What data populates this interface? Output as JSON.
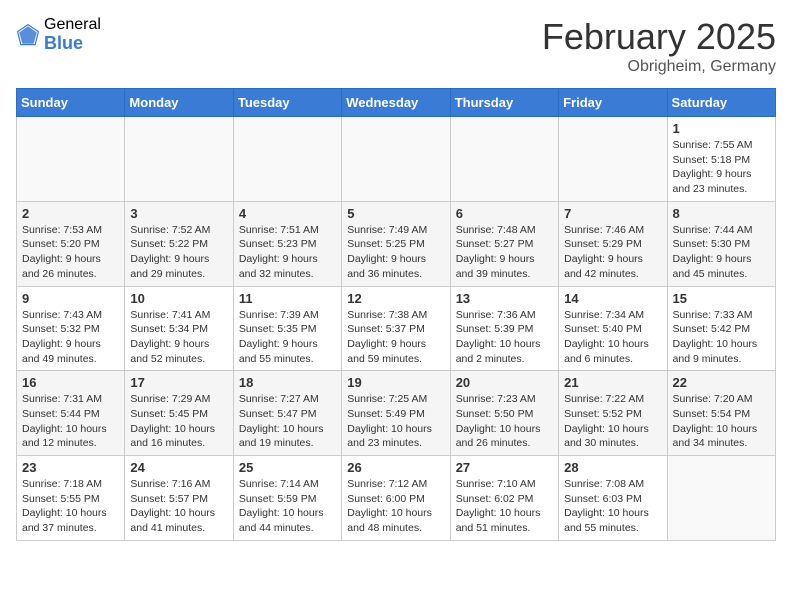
{
  "header": {
    "logo_general": "General",
    "logo_blue": "Blue",
    "month_title": "February 2025",
    "location": "Obrigheim, Germany"
  },
  "days_of_week": [
    "Sunday",
    "Monday",
    "Tuesday",
    "Wednesday",
    "Thursday",
    "Friday",
    "Saturday"
  ],
  "weeks": [
    [
      {
        "day": "",
        "info": ""
      },
      {
        "day": "",
        "info": ""
      },
      {
        "day": "",
        "info": ""
      },
      {
        "day": "",
        "info": ""
      },
      {
        "day": "",
        "info": ""
      },
      {
        "day": "",
        "info": ""
      },
      {
        "day": "1",
        "info": "Sunrise: 7:55 AM\nSunset: 5:18 PM\nDaylight: 9 hours and 23 minutes."
      }
    ],
    [
      {
        "day": "2",
        "info": "Sunrise: 7:53 AM\nSunset: 5:20 PM\nDaylight: 9 hours and 26 minutes."
      },
      {
        "day": "3",
        "info": "Sunrise: 7:52 AM\nSunset: 5:22 PM\nDaylight: 9 hours and 29 minutes."
      },
      {
        "day": "4",
        "info": "Sunrise: 7:51 AM\nSunset: 5:23 PM\nDaylight: 9 hours and 32 minutes."
      },
      {
        "day": "5",
        "info": "Sunrise: 7:49 AM\nSunset: 5:25 PM\nDaylight: 9 hours and 36 minutes."
      },
      {
        "day": "6",
        "info": "Sunrise: 7:48 AM\nSunset: 5:27 PM\nDaylight: 9 hours and 39 minutes."
      },
      {
        "day": "7",
        "info": "Sunrise: 7:46 AM\nSunset: 5:29 PM\nDaylight: 9 hours and 42 minutes."
      },
      {
        "day": "8",
        "info": "Sunrise: 7:44 AM\nSunset: 5:30 PM\nDaylight: 9 hours and 45 minutes."
      }
    ],
    [
      {
        "day": "9",
        "info": "Sunrise: 7:43 AM\nSunset: 5:32 PM\nDaylight: 9 hours and 49 minutes."
      },
      {
        "day": "10",
        "info": "Sunrise: 7:41 AM\nSunset: 5:34 PM\nDaylight: 9 hours and 52 minutes."
      },
      {
        "day": "11",
        "info": "Sunrise: 7:39 AM\nSunset: 5:35 PM\nDaylight: 9 hours and 55 minutes."
      },
      {
        "day": "12",
        "info": "Sunrise: 7:38 AM\nSunset: 5:37 PM\nDaylight: 9 hours and 59 minutes."
      },
      {
        "day": "13",
        "info": "Sunrise: 7:36 AM\nSunset: 5:39 PM\nDaylight: 10 hours and 2 minutes."
      },
      {
        "day": "14",
        "info": "Sunrise: 7:34 AM\nSunset: 5:40 PM\nDaylight: 10 hours and 6 minutes."
      },
      {
        "day": "15",
        "info": "Sunrise: 7:33 AM\nSunset: 5:42 PM\nDaylight: 10 hours and 9 minutes."
      }
    ],
    [
      {
        "day": "16",
        "info": "Sunrise: 7:31 AM\nSunset: 5:44 PM\nDaylight: 10 hours and 12 minutes."
      },
      {
        "day": "17",
        "info": "Sunrise: 7:29 AM\nSunset: 5:45 PM\nDaylight: 10 hours and 16 minutes."
      },
      {
        "day": "18",
        "info": "Sunrise: 7:27 AM\nSunset: 5:47 PM\nDaylight: 10 hours and 19 minutes."
      },
      {
        "day": "19",
        "info": "Sunrise: 7:25 AM\nSunset: 5:49 PM\nDaylight: 10 hours and 23 minutes."
      },
      {
        "day": "20",
        "info": "Sunrise: 7:23 AM\nSunset: 5:50 PM\nDaylight: 10 hours and 26 minutes."
      },
      {
        "day": "21",
        "info": "Sunrise: 7:22 AM\nSunset: 5:52 PM\nDaylight: 10 hours and 30 minutes."
      },
      {
        "day": "22",
        "info": "Sunrise: 7:20 AM\nSunset: 5:54 PM\nDaylight: 10 hours and 34 minutes."
      }
    ],
    [
      {
        "day": "23",
        "info": "Sunrise: 7:18 AM\nSunset: 5:55 PM\nDaylight: 10 hours and 37 minutes."
      },
      {
        "day": "24",
        "info": "Sunrise: 7:16 AM\nSunset: 5:57 PM\nDaylight: 10 hours and 41 minutes."
      },
      {
        "day": "25",
        "info": "Sunrise: 7:14 AM\nSunset: 5:59 PM\nDaylight: 10 hours and 44 minutes."
      },
      {
        "day": "26",
        "info": "Sunrise: 7:12 AM\nSunset: 6:00 PM\nDaylight: 10 hours and 48 minutes."
      },
      {
        "day": "27",
        "info": "Sunrise: 7:10 AM\nSunset: 6:02 PM\nDaylight: 10 hours and 51 minutes."
      },
      {
        "day": "28",
        "info": "Sunrise: 7:08 AM\nSunset: 6:03 PM\nDaylight: 10 hours and 55 minutes."
      },
      {
        "day": "",
        "info": ""
      }
    ]
  ]
}
